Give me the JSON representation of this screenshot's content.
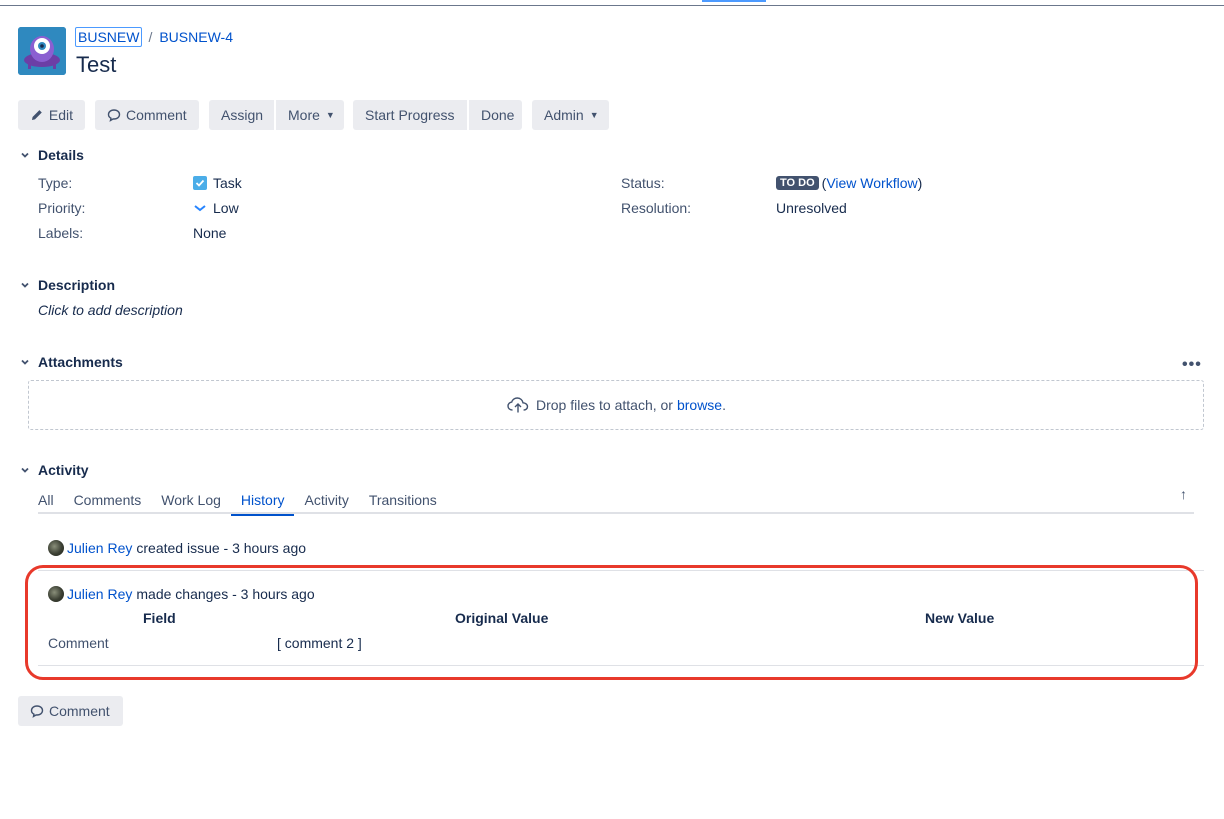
{
  "breadcrumb": {
    "project": "BUSNEW",
    "separator": "/",
    "issue_key": "BUSNEW-4"
  },
  "issue": {
    "title": "Test"
  },
  "toolbar": {
    "edit": "Edit",
    "comment": "Comment",
    "assign": "Assign",
    "more": "More",
    "start_progress": "Start Progress",
    "done": "Done",
    "admin": "Admin"
  },
  "details": {
    "heading": "Details",
    "type_label": "Type:",
    "type_value": "Task",
    "priority_label": "Priority:",
    "priority_value": "Low",
    "labels_label": "Labels:",
    "labels_value": "None",
    "status_label": "Status:",
    "status_lozenge": "TO DO",
    "status_open_paren": "(",
    "status_link": "View Workflow",
    "status_close_paren": ")",
    "resolution_label": "Resolution:",
    "resolution_value": "Unresolved"
  },
  "description": {
    "heading": "Description",
    "placeholder": "Click to add description"
  },
  "attachments": {
    "heading": "Attachments",
    "more": "•••",
    "drop_text": "Drop files to attach, or ",
    "browse": "browse",
    "period": "."
  },
  "activity": {
    "heading": "Activity",
    "tabs": [
      "All",
      "Comments",
      "Work Log",
      "History",
      "Activity",
      "Transitions"
    ],
    "active_tab": "History",
    "sort_icon": "↑"
  },
  "history": [
    {
      "user": "Julien Rey",
      "text": "created issue - 3 hours ago"
    },
    {
      "user": "Julien Rey",
      "text": "made changes - 3 hours ago"
    }
  ],
  "change_table": {
    "headers": [
      "Field",
      "Original Value",
      "New Value"
    ],
    "rows": [
      {
        "field": "Comment",
        "original": "[ comment 2 ]",
        "new": ""
      }
    ]
  },
  "bottom": {
    "comment": "Comment"
  },
  "colors": {
    "accent": "#0052cc",
    "highlight": "#e8392b",
    "lozenge": "#42526e"
  },
  "icons": [
    "project-avatar-icon",
    "pencil-icon",
    "comment-icon",
    "chevron-down-icon",
    "checkbox-task-icon",
    "priority-low-icon",
    "cloud-upload-icon",
    "more-icon",
    "sort-arrow-icon",
    "user-avatar"
  ]
}
